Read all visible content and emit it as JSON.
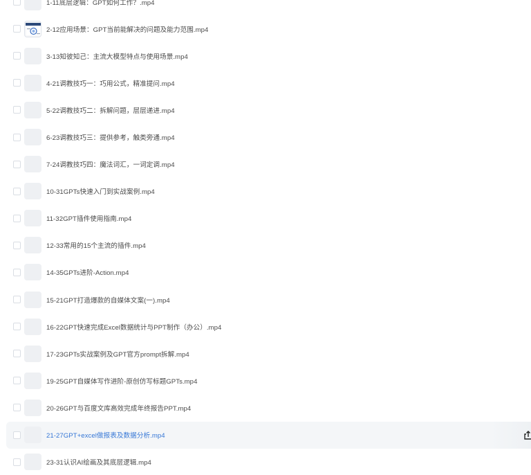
{
  "files": [
    {
      "name": "1-11底层逻辑：GPT如何工作？.mp4",
      "thumbnail": "blank"
    },
    {
      "name": "2-12应用场景：GPT当前能解决的问题及能力范围.mp4",
      "thumbnail": "video"
    },
    {
      "name": "3-13知彼知己：主流大模型特点与使用场景.mp4",
      "thumbnail": "blank"
    },
    {
      "name": "4-21调教技巧一：巧用公式，精准提问.mp4",
      "thumbnail": "blank"
    },
    {
      "name": "5-22调教技巧二：拆解问题，层层递进.mp4",
      "thumbnail": "blank"
    },
    {
      "name": "6-23调教技巧三：提供参考，触类旁通.mp4",
      "thumbnail": "blank"
    },
    {
      "name": "7-24调教技巧四：魔法词汇，一词定调.mp4",
      "thumbnail": "blank"
    },
    {
      "name": "10-31GPTs快速入门到实战案例.mp4",
      "thumbnail": "blank"
    },
    {
      "name": "11-32GPT插件使用指南.mp4",
      "thumbnail": "blank"
    },
    {
      "name": "12-33常用的15个主流的插件.mp4",
      "thumbnail": "blank"
    },
    {
      "name": "14-35GPTs进阶-Action.mp4",
      "thumbnail": "blank"
    },
    {
      "name": "15-21GPT打造爆款的自媒体文案(一).mp4",
      "thumbnail": "blank"
    },
    {
      "name": "16-22GPT快速完成Excel数据统计与PPT制作（办公）.mp4",
      "thumbnail": "blank"
    },
    {
      "name": "17-23GPTs实战案例及GPT官方prompt拆解.mp4",
      "thumbnail": "blank"
    },
    {
      "name": "19-25GPT自媒体写作进阶-原创仿写标题GPTs.mp4",
      "thumbnail": "blank"
    },
    {
      "name": "20-26GPT与百度文库高效完成年终报告PPT.mp4",
      "thumbnail": "blank"
    },
    {
      "name": "21-27GPT+excel做报表及数据分析.mp4",
      "thumbnail": "blank",
      "highlighted": true,
      "action_icon": "share-icon"
    },
    {
      "name": "23-31认识AI绘画及其底层逻辑.mp4",
      "thumbnail": "blank"
    }
  ],
  "colors": {
    "highlight_bg": "#f4f6f8",
    "highlight_text": "#3677d6",
    "text": "#4a4a4a",
    "thumb_bg": "#eef0f3"
  }
}
